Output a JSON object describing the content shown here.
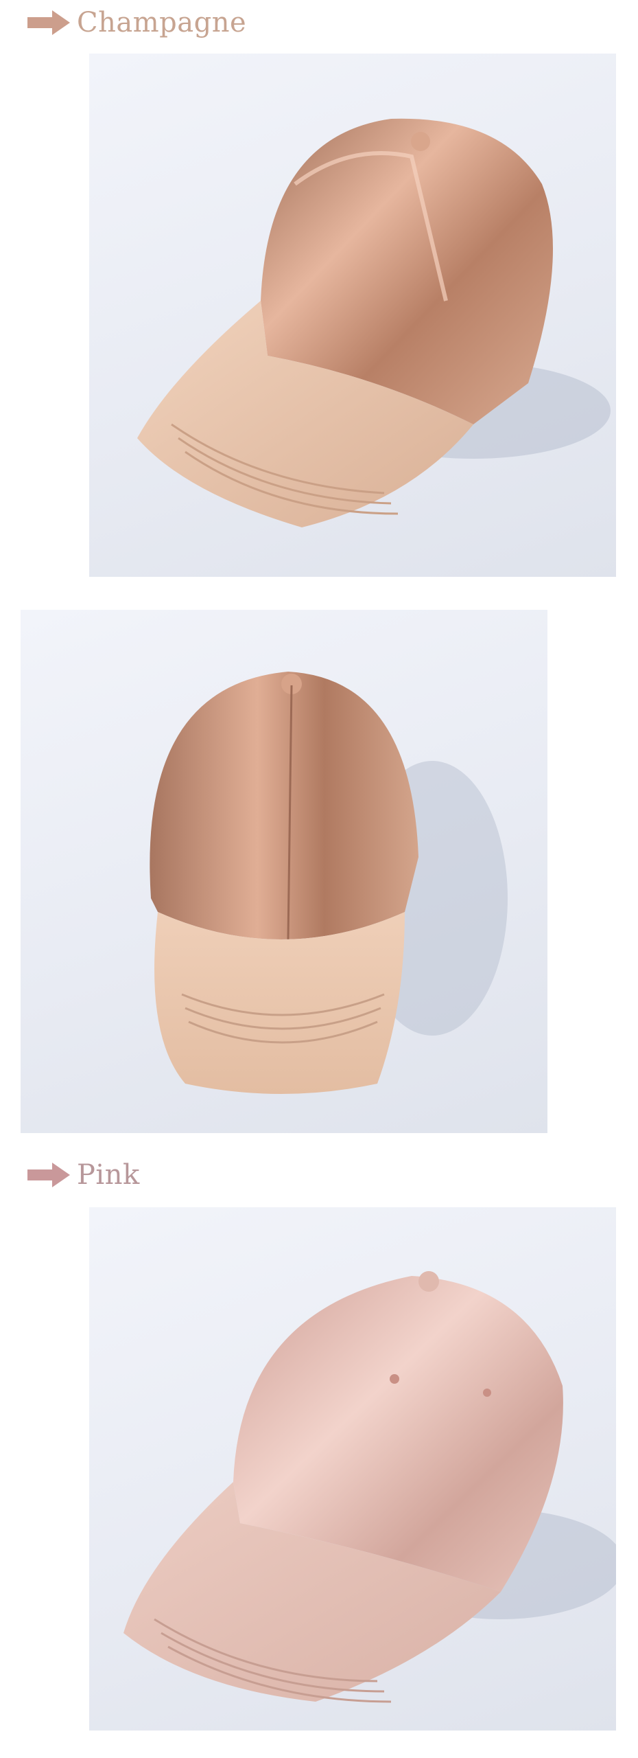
{
  "colors": {
    "accent": "#cc9e8c",
    "heading_text": "#c7a491",
    "pink_accent": "#c9989a",
    "pink_text": "#b7979a",
    "background": "#ffffff",
    "photo_backdrop": "#e9ecf3",
    "champagne_crown": "#c9967d",
    "champagne_brim": "#e7c5ad",
    "pink_crown": "#ddb2a8",
    "pink_brim": "#e6c3b8"
  },
  "sections": [
    {
      "title": "Champagne",
      "arrow_icon": "right-arrow-icon",
      "photos": [
        {
          "subject": "champagne-satin-cap-angle-view"
        },
        {
          "subject": "champagne-satin-cap-front-view"
        }
      ]
    },
    {
      "title": "Pink",
      "arrow_icon": "right-arrow-icon",
      "photos": [
        {
          "subject": "pink-satin-cap-angle-view"
        }
      ]
    }
  ]
}
